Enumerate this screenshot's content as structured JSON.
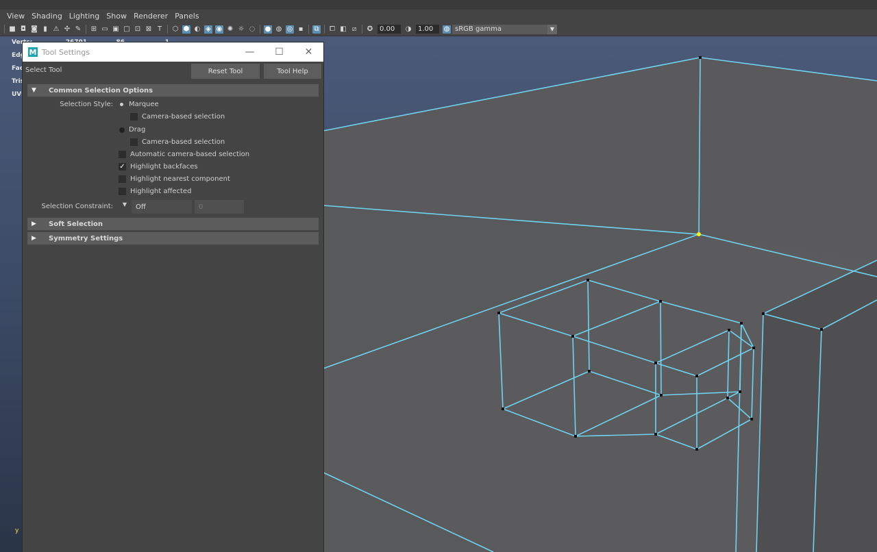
{
  "menu": [
    "View",
    "Shading",
    "Lighting",
    "Show",
    "Renderer",
    "Panels"
  ],
  "toolbar": {
    "exposure": "0.00",
    "gamma_value": "1.00",
    "color_space": "sRGB gamma"
  },
  "hud": {
    "rows": [
      {
        "label": "Verts:",
        "value1": "26701",
        "value2": "86",
        "value3": "1"
      },
      {
        "label": "Edg",
        "value1": "",
        "value2": "",
        "value3": ""
      },
      {
        "label": "Fac",
        "value1": "",
        "value2": "",
        "value3": ""
      },
      {
        "label": "Tris",
        "value1": "",
        "value2": "",
        "value3": ""
      },
      {
        "label": "UVs",
        "value1": "",
        "value2": "",
        "value3": ""
      }
    ]
  },
  "axis_label": "y",
  "dialog": {
    "window_title": "Tool Settings",
    "logo_letter": "M",
    "tool_name": "Select Tool",
    "reset_label": "Reset Tool",
    "help_label": "Tool Help",
    "section_common": "Common Selection Options",
    "selection_style_label": "Selection Style:",
    "marquee_label": "Marquee",
    "camera_based_1": "Camera-based selection",
    "drag_label": "Drag",
    "camera_based_2": "Camera-based selection",
    "auto_camera": "Automatic camera-based selection",
    "highlight_backfaces": "Highlight backfaces",
    "highlight_nearest": "Highlight nearest component",
    "highlight_affected": "Highlight affected",
    "constraint_label": "Selection Constraint:",
    "constraint_value": "Off",
    "constraint_number": "0",
    "section_soft": "Soft Selection",
    "section_symmetry": "Symmetry Settings",
    "checked": {
      "highlight_backfaces": true,
      "auto_camera": false,
      "highlight_nearest": false,
      "highlight_affected": false,
      "camera_based_1": false,
      "camera_based_2": false
    },
    "selection_style": "Marquee"
  },
  "colors": {
    "wire": "#6fd3f0",
    "selected_vertex": "#f2f21a",
    "panel": "#444444"
  }
}
